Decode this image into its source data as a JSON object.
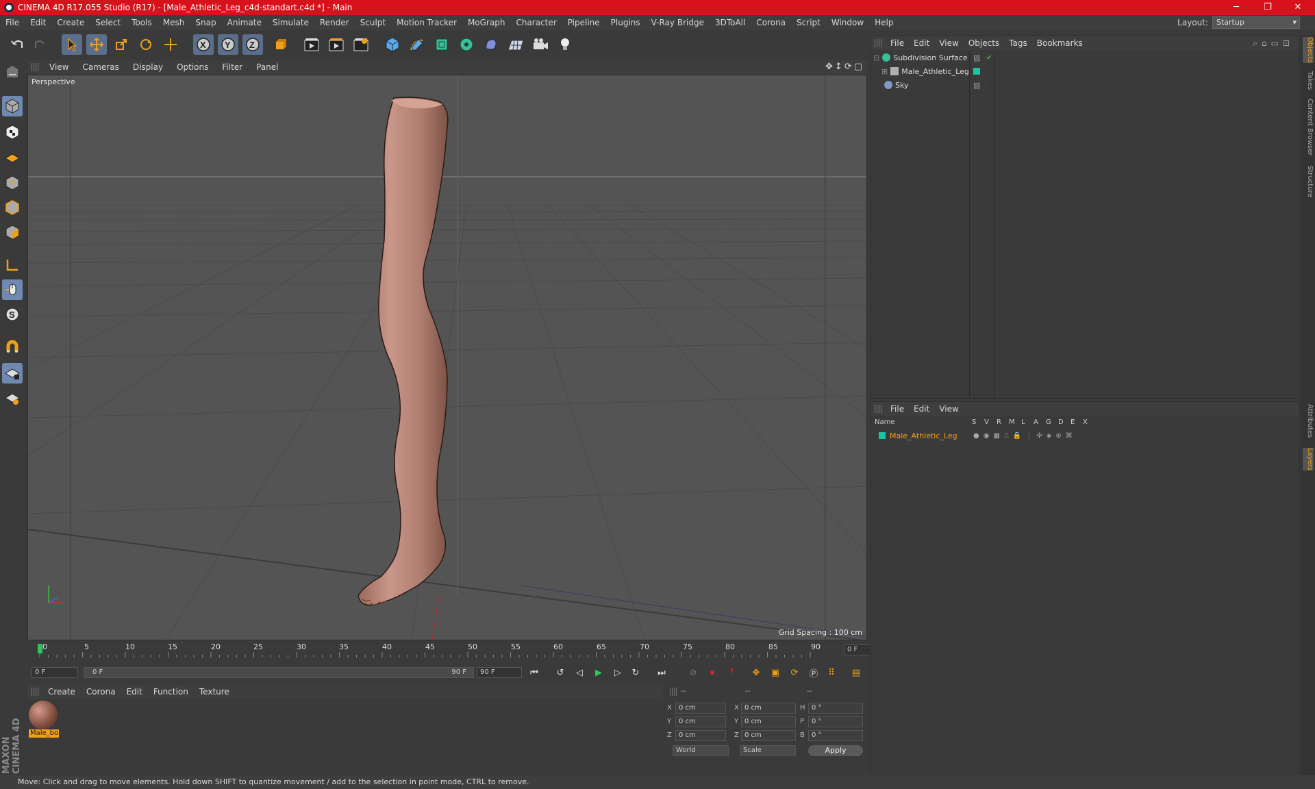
{
  "window": {
    "title": "CINEMA 4D R17.055 Studio (R17) - [Male_Athletic_Leg_c4d-standart.c4d *] - Main"
  },
  "menu": [
    "File",
    "Edit",
    "Create",
    "Select",
    "Tools",
    "Mesh",
    "Snap",
    "Animate",
    "Simulate",
    "Render",
    "Sculpt",
    "Motion Tracker",
    "MoGraph",
    "Character",
    "Pipeline",
    "Plugins",
    "V-Ray Bridge",
    "3DToAll",
    "Corona",
    "Script",
    "Window",
    "Help"
  ],
  "layout": {
    "label": "Layout:",
    "value": "Startup"
  },
  "viewport": {
    "menu": [
      "View",
      "Cameras",
      "Display",
      "Options",
      "Filter",
      "Panel"
    ],
    "label": "Perspective",
    "grid_spacing": "Grid Spacing : 100 cm"
  },
  "timeline": {
    "ticks": [
      "0",
      "5",
      "10",
      "15",
      "20",
      "25",
      "30",
      "35",
      "40",
      "45",
      "50",
      "55",
      "60",
      "65",
      "70",
      "75",
      "80",
      "85",
      "90"
    ],
    "current": "0 F",
    "start": "0 F",
    "range_start": "0 F",
    "range_end": "90 F",
    "end": "90 F"
  },
  "materials": {
    "menu": [
      "Create",
      "Corona",
      "Edit",
      "Function",
      "Texture"
    ],
    "items": [
      {
        "label": "Male_bo"
      }
    ]
  },
  "coords": {
    "header": [
      "--",
      "--",
      "--"
    ],
    "rows": [
      {
        "a": "X",
        "av": "0 cm",
        "b": "X",
        "bv": "0 cm",
        "c": "H",
        "cv": "0 °"
      },
      {
        "a": "Y",
        "av": "0 cm",
        "b": "Y",
        "bv": "0 cm",
        "c": "P",
        "cv": "0 °"
      },
      {
        "a": "Z",
        "av": "0 cm",
        "b": "Z",
        "bv": "0 cm",
        "c": "B",
        "cv": "0 °"
      }
    ],
    "space": "World",
    "mode": "Scale",
    "apply": "Apply"
  },
  "objects": {
    "menu": [
      "File",
      "Edit",
      "View",
      "Objects",
      "Tags",
      "Bookmarks"
    ],
    "items": [
      {
        "name": "Subdivision Surface",
        "color": "#3bbf9a"
      },
      {
        "name": "Male_Athletic_Leg",
        "color": "#b0b0b0"
      },
      {
        "name": "Sky",
        "color": "#7a9cc8"
      }
    ]
  },
  "layers": {
    "menu": [
      "File",
      "Edit",
      "View"
    ],
    "columns": [
      "Name",
      "S",
      "V",
      "R",
      "M",
      "L",
      "A",
      "G",
      "D",
      "E",
      "X"
    ],
    "items": [
      {
        "name": "Male_Athletic_Leg",
        "color": "#19c4a4"
      }
    ]
  },
  "side_tabs": [
    "Objects",
    "Takes",
    "Content Browser",
    "Structure",
    "Attributes",
    "Layers"
  ],
  "status": "Move: Click and drag to move elements. Hold down SHIFT to quantize movement / add to the selection in point mode, CTRL to remove.",
  "brand": "MAXON CINEMA 4D",
  "colors": {
    "title_bar": "#d8121c",
    "accent": "#f1a01a",
    "selected_tool": "#6f89b0"
  }
}
